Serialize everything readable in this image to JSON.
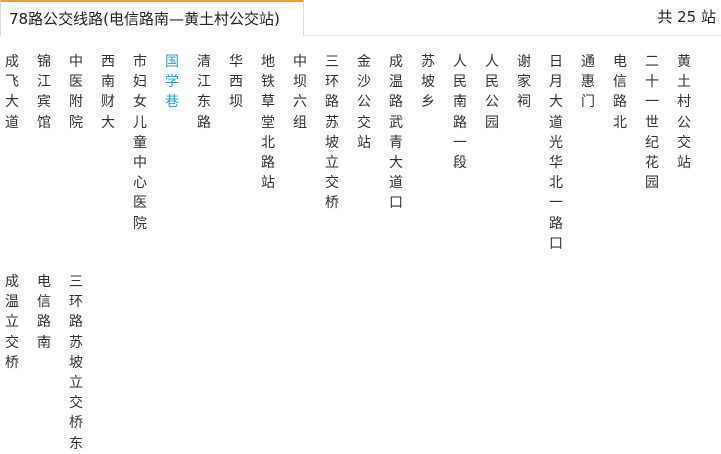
{
  "header": {
    "title": "78路公交线路(电信路南—黄土村公交站)",
    "count": "共 25 站"
  },
  "stops": [
    {
      "name": "成飞大道"
    },
    {
      "name": "锦江宾馆"
    },
    {
      "name": "中医附院"
    },
    {
      "name": "西南财大"
    },
    {
      "name": "市妇女儿童中心医院"
    },
    {
      "name": "国学巷",
      "active": true
    },
    {
      "name": "清江东路"
    },
    {
      "name": "华西坝"
    },
    {
      "name": "地铁草堂北路站"
    },
    {
      "name": "中坝六组"
    },
    {
      "name": "三环路苏坡立交桥"
    },
    {
      "name": "金沙公交站"
    },
    {
      "name": "成温路武青大道口"
    },
    {
      "name": "苏坡乡"
    },
    {
      "name": "人民南路一段"
    },
    {
      "name": "人民公园"
    },
    {
      "name": "谢家祠"
    },
    {
      "name": "日月大道光华北一路口"
    },
    {
      "name": "通惠门"
    },
    {
      "name": "电信路北"
    },
    {
      "name": "二十一世纪花园"
    },
    {
      "name": "黄土村公交站"
    },
    {
      "name": "成温立交桥"
    },
    {
      "name": "电信路南"
    },
    {
      "name": "三环路苏坡立交桥东"
    }
  ],
  "colors": {
    "accent_tab_border": "#f39c38",
    "active_stop": "#2a9fd6",
    "text": "#333333"
  }
}
